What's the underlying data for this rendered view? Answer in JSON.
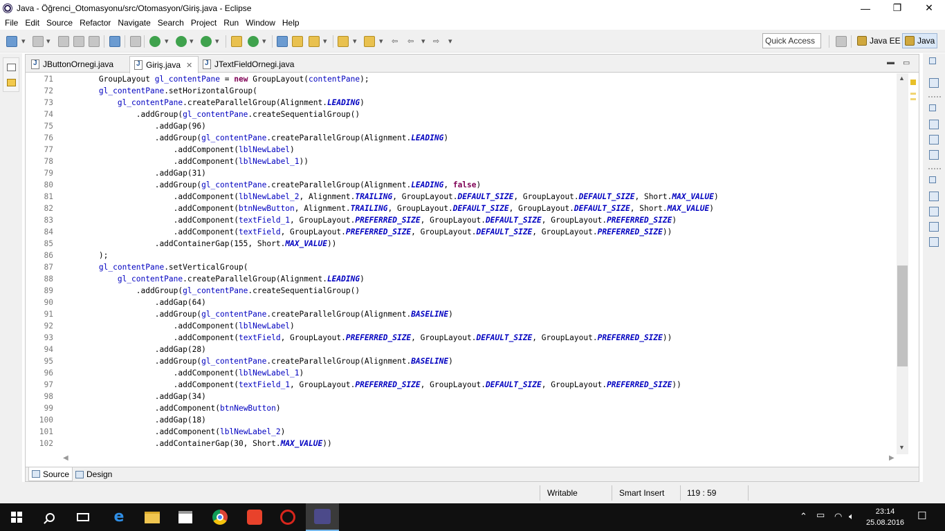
{
  "window": {
    "title": "Java - Öğrenci_Otomasyonu/src/Otomasyon/Giriş.java - Eclipse",
    "minimize": "—",
    "restore": "❐",
    "close": "✕"
  },
  "menu": [
    "File",
    "Edit",
    "Source",
    "Refactor",
    "Navigate",
    "Search",
    "Project",
    "Run",
    "Window",
    "Help"
  ],
  "toolbar": {
    "quick_access": "Quick Access",
    "perspectives": [
      {
        "label": "Java EE",
        "active": false
      },
      {
        "label": "Java",
        "active": true
      }
    ]
  },
  "editor": {
    "tabs": [
      {
        "label": "JButtonOrnegi.java",
        "active": false
      },
      {
        "label": "Giriş.java",
        "active": true
      },
      {
        "label": "JTextFieldOrnegi.java",
        "active": false
      }
    ],
    "tab_close": "✕",
    "lines": [
      {
        "n": "71",
        "code": "        GroupLayout gl_contentPane = new GroupLayout(contentPane);"
      },
      {
        "n": "72",
        "code": "        gl_contentPane.setHorizontalGroup("
      },
      {
        "n": "73",
        "code": "            gl_contentPane.createParallelGroup(Alignment.LEADING)"
      },
      {
        "n": "74",
        "code": "                .addGroup(gl_contentPane.createSequentialGroup()"
      },
      {
        "n": "75",
        "code": "                    .addGap(96)"
      },
      {
        "n": "76",
        "code": "                    .addGroup(gl_contentPane.createParallelGroup(Alignment.LEADING)"
      },
      {
        "n": "77",
        "code": "                        .addComponent(lblNewLabel)"
      },
      {
        "n": "78",
        "code": "                        .addComponent(lblNewLabel_1))"
      },
      {
        "n": "79",
        "code": "                    .addGap(31)"
      },
      {
        "n": "80",
        "code": "                    .addGroup(gl_contentPane.createParallelGroup(Alignment.LEADING, false)"
      },
      {
        "n": "81",
        "code": "                        .addComponent(lblNewLabel_2, Alignment.TRAILING, GroupLayout.DEFAULT_SIZE, GroupLayout.DEFAULT_SIZE, Short.MAX_VALUE)"
      },
      {
        "n": "82",
        "code": "                        .addComponent(btnNewButton, Alignment.TRAILING, GroupLayout.DEFAULT_SIZE, GroupLayout.DEFAULT_SIZE, Short.MAX_VALUE)"
      },
      {
        "n": "83",
        "code": "                        .addComponent(textField_1, GroupLayout.PREFERRED_SIZE, GroupLayout.DEFAULT_SIZE, GroupLayout.PREFERRED_SIZE)"
      },
      {
        "n": "84",
        "code": "                        .addComponent(textField, GroupLayout.PREFERRED_SIZE, GroupLayout.DEFAULT_SIZE, GroupLayout.PREFERRED_SIZE))"
      },
      {
        "n": "85",
        "code": "                    .addContainerGap(155, Short.MAX_VALUE))"
      },
      {
        "n": "86",
        "code": "        );"
      },
      {
        "n": "87",
        "code": "        gl_contentPane.setVerticalGroup("
      },
      {
        "n": "88",
        "code": "            gl_contentPane.createParallelGroup(Alignment.LEADING)"
      },
      {
        "n": "89",
        "code": "                .addGroup(gl_contentPane.createSequentialGroup()"
      },
      {
        "n": "90",
        "code": "                    .addGap(64)"
      },
      {
        "n": "91",
        "code": "                    .addGroup(gl_contentPane.createParallelGroup(Alignment.BASELINE)"
      },
      {
        "n": "92",
        "code": "                        .addComponent(lblNewLabel)"
      },
      {
        "n": "93",
        "code": "                        .addComponent(textField, GroupLayout.PREFERRED_SIZE, GroupLayout.DEFAULT_SIZE, GroupLayout.PREFERRED_SIZE))"
      },
      {
        "n": "94",
        "code": "                    .addGap(28)"
      },
      {
        "n": "95",
        "code": "                    .addGroup(gl_contentPane.createParallelGroup(Alignment.BASELINE)"
      },
      {
        "n": "96",
        "code": "                        .addComponent(lblNewLabel_1)"
      },
      {
        "n": "97",
        "code": "                        .addComponent(textField_1, GroupLayout.PREFERRED_SIZE, GroupLayout.DEFAULT_SIZE, GroupLayout.PREFERRED_SIZE))"
      },
      {
        "n": "98",
        "code": "                    .addGap(34)"
      },
      {
        "n": "99",
        "code": "                    .addComponent(btnNewButton)"
      },
      {
        "n": "100",
        "code": "                    .addGap(18)"
      },
      {
        "n": "101",
        "code": "                    .addComponent(lblNewLabel_2)"
      },
      {
        "n": "102",
        "code": "                    .addContainerGap(30, Short.MAX_VALUE))"
      }
    ],
    "bottom_tabs": [
      {
        "label": "Source",
        "active": true
      },
      {
        "label": "Design",
        "active": false
      }
    ]
  },
  "status": {
    "writable": "Writable",
    "insert_mode": "Smart Insert",
    "cursor": "119 : 59"
  },
  "taskbar": {
    "time": "23:14",
    "date": "25.08.2016",
    "tray_icons": [
      "chevron-up-icon",
      "battery-icon",
      "wifi-icon",
      "volume-icon"
    ],
    "tray_glyphs": {
      "chevron": "⌃",
      "battery": "▭",
      "wifi": "◠",
      "volume": "🔈︎",
      "notification": "☐"
    }
  },
  "colors": {
    "field": "#0000c0",
    "keyword": "#7f0055",
    "line_number": "#787878",
    "taskbar": "#101010"
  }
}
